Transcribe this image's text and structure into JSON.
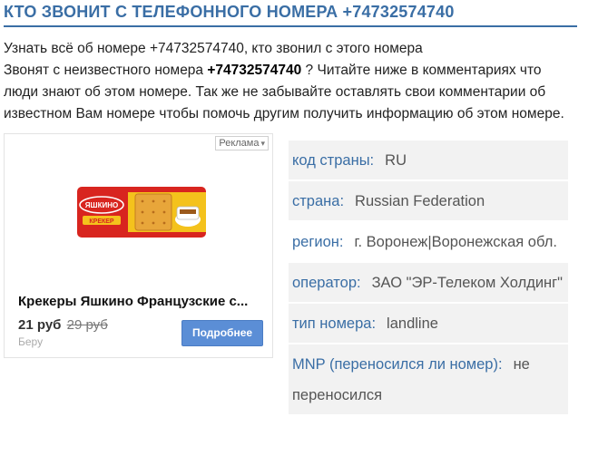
{
  "page": {
    "title": "КТО ЗВОНИТ С ТЕЛЕФОННОГО НОМЕРА +74732574740"
  },
  "intro": {
    "line1": "Узнать всё об номере +74732574740, кто звонил с этого номера",
    "line2_prefix": "Звонят с неизвестного номера ",
    "line2_number": "+74732574740",
    "line2_suffix": " ? Читайте ниже в комментариях что люди знают об этом номере. Так же не забывайте оставлять свои комментарии об известном Вам номере чтобы помочь другим получить информацию об этом номере."
  },
  "ad": {
    "badge": "Реклама",
    "badge_icon": "chevron-down-icon",
    "product_title": "Крекеры Яшкино Французские с...",
    "price": "21 руб",
    "old_price": "29 руб",
    "store": "Беру",
    "button_label": "Подробнее",
    "package_brand": "ЯШКИНО",
    "package_text": "КРЕКЕР",
    "colors": {
      "package_red": "#d8251f",
      "package_yellow": "#f4c21c",
      "button": "#5b8ed6"
    }
  },
  "info": {
    "rows": [
      {
        "key": "код страны:",
        "value": "RU"
      },
      {
        "key": "страна:",
        "value": "Russian Federation"
      },
      {
        "key": "регион:",
        "value": "г. Воронеж|Воронежская обл."
      },
      {
        "key": "оператор:",
        "value": "ЗАО \"ЭР-Телеком Холдинг\""
      },
      {
        "key": "тип номера:",
        "value": "landline"
      },
      {
        "key": "MNP (переносился ли номер):",
        "value": "не переносился"
      }
    ]
  },
  "colors": {
    "accent": "#3a6ea5",
    "row_shade": "#f2f2f2"
  }
}
